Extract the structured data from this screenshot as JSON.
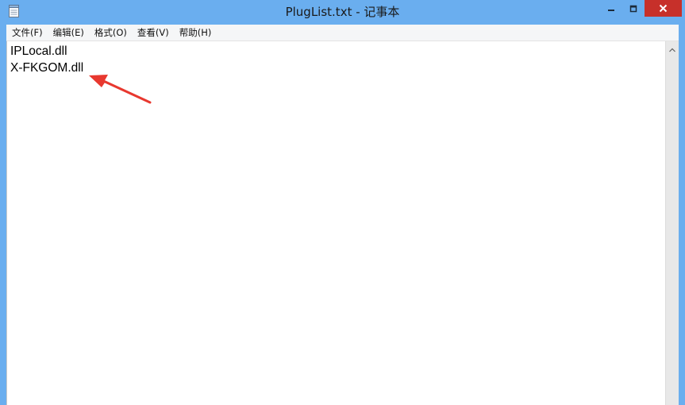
{
  "window": {
    "title": "PlugList.txt - 记事本"
  },
  "menu": {
    "items": [
      {
        "id": "file",
        "label": "文件(F)"
      },
      {
        "id": "edit",
        "label": "编辑(E)"
      },
      {
        "id": "format",
        "label": "格式(O)"
      },
      {
        "id": "view",
        "label": "查看(V)"
      },
      {
        "id": "help",
        "label": "帮助(H)"
      }
    ]
  },
  "editor": {
    "lines": [
      "IPLocal.dll",
      "X-FKGOM.dll"
    ]
  },
  "colors": {
    "titlebar": "#6aaeef",
    "close_button": "#c7302a",
    "annotation_arrow": "#e8382f"
  },
  "icons": {
    "app": "notepad-icon",
    "minimize": "minimize-icon",
    "maximize": "maximize-icon",
    "close": "close-icon",
    "scroll_up": "chevron-up-icon",
    "annotation": "red-arrow-icon"
  }
}
